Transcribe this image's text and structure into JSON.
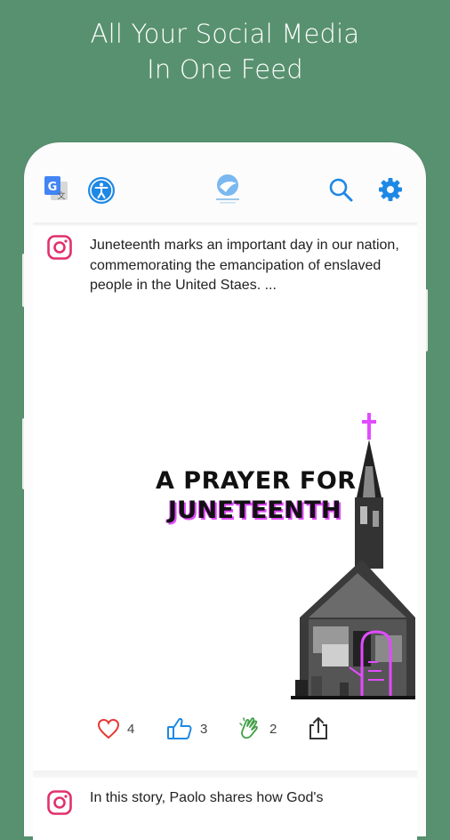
{
  "promo": {
    "line1": "All Your Social Media",
    "line2": "In One Feed"
  },
  "topbar": {
    "icons": [
      "translate-icon",
      "accessibility-icon",
      "app-logo",
      "search-icon",
      "settings-gear-icon"
    ],
    "accent_color": "#1e88e5"
  },
  "posts": [
    {
      "source_icon": "instagram-icon",
      "text": "Juneteenth marks an important day in our nation, commemorating the emancipation of enslaved people in the United Staes. ...",
      "image": {
        "line1": "A PRAYER FOR",
        "line2": "JUNETEENTH"
      },
      "reactions": {
        "love": "4",
        "like": "3",
        "clap": "2"
      }
    },
    {
      "source_icon": "instagram-icon",
      "text": "In this story, Paolo shares how God's"
    }
  ],
  "colors": {
    "background": "#58916f",
    "instagram": "#e1306c",
    "heart": "#e53935",
    "clap": "#43a047",
    "pink": "#e24bff"
  }
}
